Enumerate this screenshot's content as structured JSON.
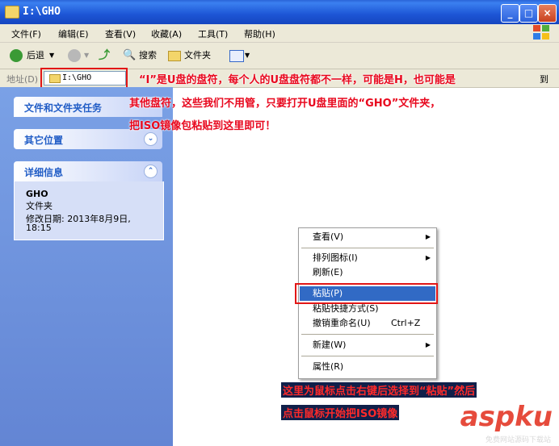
{
  "window": {
    "title": "I:\\GHO",
    "min": "_",
    "max": "□",
    "close": "×"
  },
  "menu": [
    "文件(F)",
    "编辑(E)",
    "查看(V)",
    "收藏(A)",
    "工具(T)",
    "帮助(H)"
  ],
  "toolbar": {
    "back": "后退",
    "search": "搜索",
    "folders": "文件夹"
  },
  "address": {
    "label": "地址(D)",
    "value": "I:\\GHO",
    "go": "到"
  },
  "sidebar": {
    "tasks": "文件和文件夹任务",
    "other": "其它位置",
    "details": {
      "header": "详细信息",
      "name": "GHO",
      "type": "文件夹",
      "modified_label": "修改日期: 2013年8月9日,",
      "modified_time": "18:15"
    }
  },
  "context_menu": {
    "items": [
      {
        "label": "查看(V)",
        "submenu": true
      },
      {
        "label": "排列图标(I)",
        "submenu": true
      },
      {
        "label": "刷新(E)"
      },
      {
        "label": "粘贴(P)",
        "highlighted": true
      },
      {
        "label": "粘贴快捷方式(S)"
      },
      {
        "label": "撤销重命名(U)",
        "shortcut": "Ctrl+Z"
      },
      {
        "label": "新建(W)",
        "submenu": true
      },
      {
        "label": "属性(R)"
      }
    ]
  },
  "annotations": {
    "top_line1": "“I”是U盘的盘符，每个人的U盘盘符都不一样，可能是H，也可能是",
    "top_line2": "其他盘符，这些我们不用管，只要打开U盘里面的“GHO”文件夹，",
    "top_line3": "把ISO镜像包粘贴到这里即可！",
    "bottom_line1": "这里为鼠标点击右键后选择到“粘贴”然后",
    "bottom_line2": "点击鼠标开始把ISO镜像"
  },
  "watermark": {
    "text": "aspku",
    "sub": "免费网站源码下载站"
  },
  "colors": {
    "xp_blue": "#1d55d5",
    "highlight": "#316ac5",
    "annotation": "#e8081e"
  }
}
